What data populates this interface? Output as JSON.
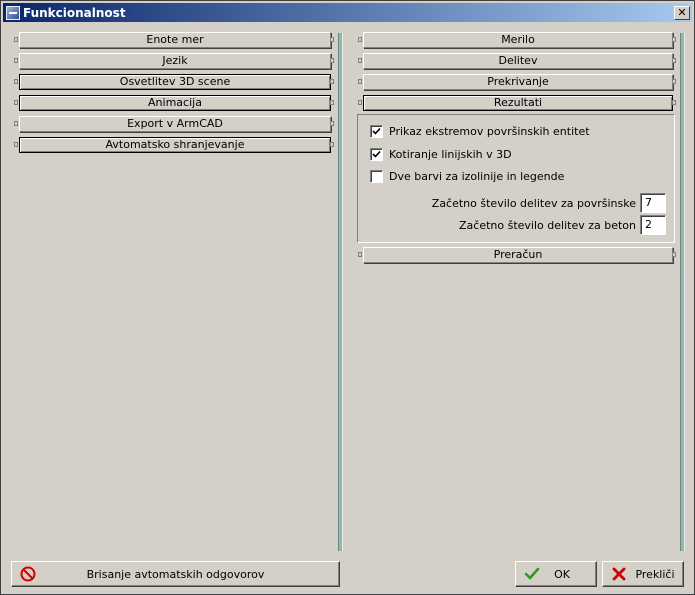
{
  "window": {
    "title": "Funkcionalnost",
    "close_glyph": "✕"
  },
  "left_panel": {
    "sections": [
      {
        "label": "Enote mer"
      },
      {
        "label": "Jezik"
      },
      {
        "label": "Osvetlitev 3D scene"
      },
      {
        "label": "Animacija"
      },
      {
        "label": "Export v ArmCAD"
      },
      {
        "label": "Avtomatsko shranjevanje"
      }
    ]
  },
  "right_panel": {
    "sections": [
      {
        "label": "Merilo"
      },
      {
        "label": "Delitev"
      },
      {
        "label": "Prekrivanje"
      },
      {
        "label": "Rezultati"
      }
    ],
    "rezultati": {
      "checkboxes": [
        {
          "label": "Prikaz ekstremov površinskih entitet",
          "checked": true
        },
        {
          "label": "Kotiranje linijskih v 3D",
          "checked": true
        },
        {
          "label": "Dve barvi za izolinije in legende",
          "checked": false
        }
      ],
      "fields": [
        {
          "label": "Začetno število delitev za površinske",
          "value": "7"
        },
        {
          "label": "Začetno število delitev za beton",
          "value": "2"
        }
      ]
    },
    "after_section": {
      "label": "Preračun"
    }
  },
  "footer": {
    "clear_button": {
      "label": "Brisanje avtomatskih odgovorov",
      "icon": "no-entry-icon"
    },
    "ok_button": {
      "label": "OK",
      "icon": "checkmark-icon"
    },
    "cancel_button": {
      "label": "Prekliči",
      "icon": "red-x-icon"
    }
  }
}
